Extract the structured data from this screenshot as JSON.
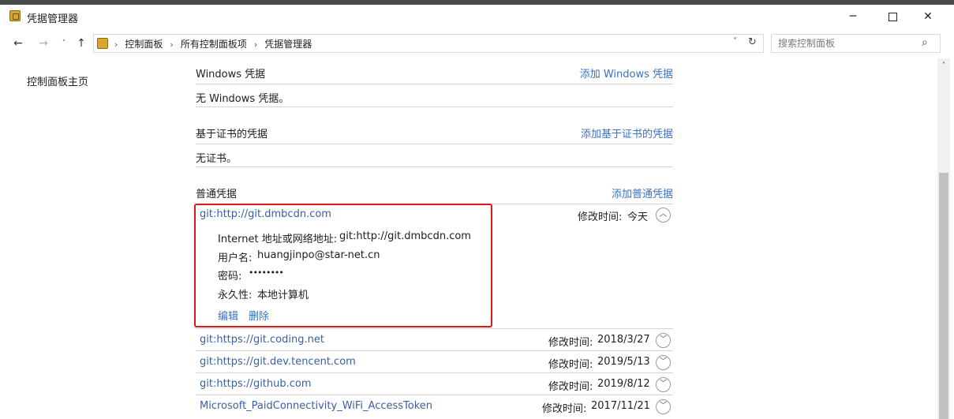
{
  "window": {
    "title": "凭据管理器",
    "minimize_glyph": "─",
    "close_glyph": "✕"
  },
  "nav": {
    "back_glyph": "←",
    "forward_glyph": "→",
    "recent_glyph": "˅",
    "up_glyph": "↑",
    "breadcrumb": [
      "控制面板",
      "所有控制面板项",
      "凭据管理器"
    ],
    "breadcrumb_sep": "›",
    "dropdown_glyph": "˅",
    "refresh_glyph": "↻"
  },
  "search": {
    "placeholder": "搜索控制面板",
    "icon_glyph": "⌕"
  },
  "sidebar": {
    "home_link": "控制面板主页"
  },
  "sections": {
    "windows": {
      "title": "Windows 凭据",
      "add_link": "添加 Windows 凭据",
      "empty_text": "无 Windows 凭据。"
    },
    "certificate": {
      "title": "基于证书的凭据",
      "add_link": "添加基于证书的凭据",
      "empty_text": "无证书。"
    },
    "generic": {
      "title": "普通凭据",
      "add_link": "添加普通凭据"
    }
  },
  "expanded_credential": {
    "name": "git:http://git.dmbcdn.com",
    "modified_label": "修改时间:",
    "modified_value": "今天",
    "address_label": "Internet 地址或网络地址:",
    "address_value": "git:http://git.dmbcdn.com",
    "username_label": "用户名:",
    "username_value": "huangjinpo@star-net.cn",
    "password_label": "密码:",
    "password_value": "••••••••",
    "persistence_label": "永久性:",
    "persistence_value": "本地计算机",
    "edit_link": "编辑",
    "delete_link": "删除",
    "collapse_glyph": "︿"
  },
  "credentials": [
    {
      "name": "git:https://git.coding.net",
      "modified_label": "修改时间:",
      "modified_value": "2018/3/27",
      "expand_glyph": "﹀"
    },
    {
      "name": "git:https://git.dev.tencent.com",
      "modified_label": "修改时间:",
      "modified_value": "2019/5/13",
      "expand_glyph": "﹀"
    },
    {
      "name": "git:https://github.com",
      "modified_label": "修改时间:",
      "modified_value": "2019/8/12",
      "expand_glyph": "﹀"
    },
    {
      "name": "Microsoft_PaidConnectivity_WiFi_AccessToken",
      "modified_label": "修改时间:",
      "modified_value": "2017/11/21",
      "expand_glyph": "﹀"
    }
  ],
  "scrollbar": {
    "up_glyph": "˄"
  },
  "colors": {
    "link": "#3872c2",
    "highlight": "#e01818"
  }
}
